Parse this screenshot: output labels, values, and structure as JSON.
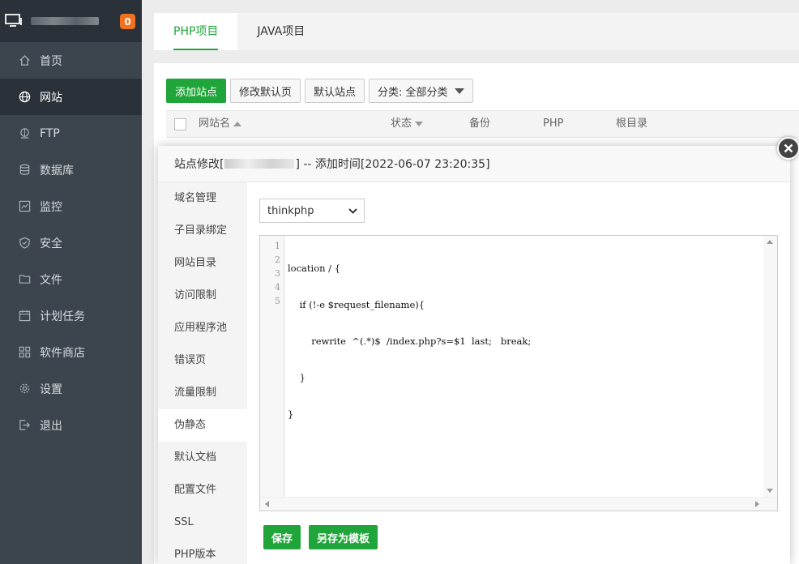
{
  "sidebar": {
    "badge": "0",
    "items": [
      {
        "label": "首页",
        "icon": "home-icon"
      },
      {
        "label": "网站",
        "icon": "globe-icon",
        "active": true
      },
      {
        "label": "FTP",
        "icon": "ftp-icon"
      },
      {
        "label": "数据库",
        "icon": "database-icon"
      },
      {
        "label": "监控",
        "icon": "monitor-chart-icon"
      },
      {
        "label": "安全",
        "icon": "shield-icon"
      },
      {
        "label": "文件",
        "icon": "folder-icon"
      },
      {
        "label": "计划任务",
        "icon": "calendar-icon"
      },
      {
        "label": "软件商店",
        "icon": "grid-icon"
      },
      {
        "label": "设置",
        "icon": "gear-icon"
      },
      {
        "label": "退出",
        "icon": "logout-icon"
      }
    ]
  },
  "tabs": [
    {
      "label": "PHP项目",
      "active": true
    },
    {
      "label": "JAVA项目"
    }
  ],
  "toolbar": {
    "add_site": "添加站点",
    "edit_default_page": "修改默认页",
    "default_site": "默认站点",
    "category": "分类: 全部分类"
  },
  "table": {
    "columns": [
      "网站名",
      "状态",
      "备份",
      "PHP",
      "根目录"
    ]
  },
  "modal": {
    "title_prefix": "站点修改[",
    "title_suffix": "] -- 添加时间[2022-06-07 23:20:35]",
    "menu": [
      "域名管理",
      "子目录绑定",
      "网站目录",
      "访问限制",
      "应用程序池",
      "错误页",
      "流量限制",
      "伪静态",
      "默认文档",
      "配置文件",
      "SSL",
      "PHP版本"
    ],
    "active_menu": "伪静态",
    "template_select": "thinkphp",
    "code_lines": [
      "location / {",
      "    if (!-e $request_filename){",
      "        rewrite  ^(.*)$  /index.php?s=$1  last;   break;",
      "    }",
      "}"
    ],
    "line_numbers": [
      "1",
      "2",
      "3",
      "4",
      "5"
    ],
    "save_button": "保存",
    "save_template_button": "另存为模板"
  },
  "colors": {
    "accent": "#20a53a",
    "sidebar_bg": "#3c444d",
    "badge": "#f0721f"
  }
}
